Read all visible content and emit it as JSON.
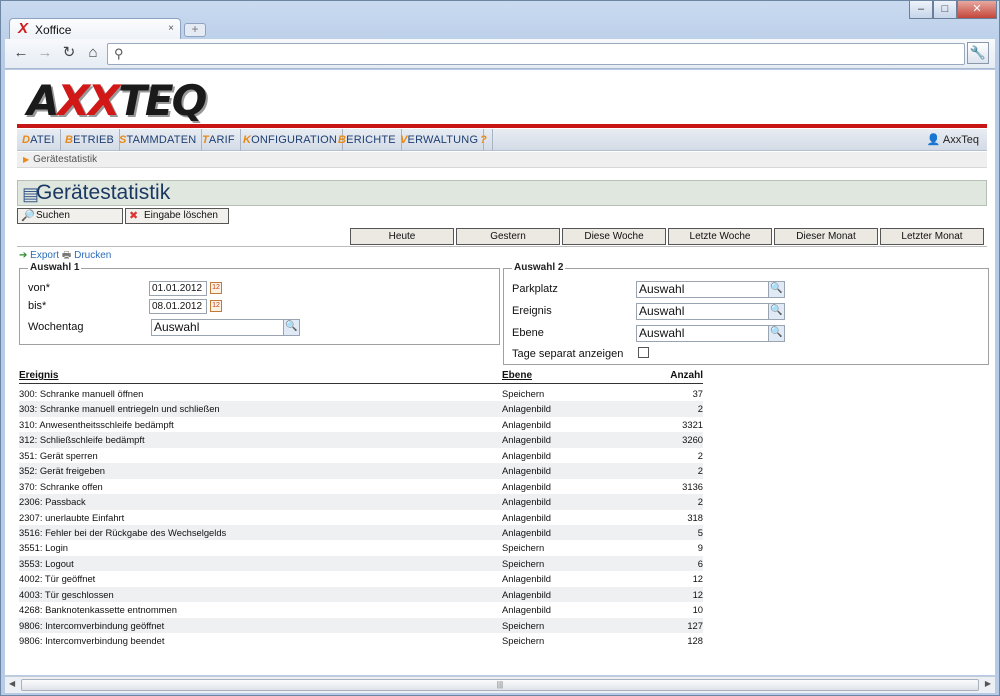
{
  "browser": {
    "tab_title": "Xoffice",
    "tab_logo": "X",
    "tab_close": "×",
    "new_tab": "+",
    "win_buttons": [
      "–",
      "□",
      "✕"
    ],
    "nav_icons": [
      "back-arrow-icon",
      "forward-arrow-icon",
      "reload-icon",
      "home-icon"
    ],
    "nav_glyphs": [
      "←",
      "→",
      "↻",
      "⌂"
    ],
    "url_icon": "⚲",
    "url_value": "",
    "wrench": "🔧"
  },
  "app": {
    "logo_a": "A",
    "logo_xx": "XX",
    "logo_teq": "TEQ",
    "menu": [
      {
        "first": "D",
        "rest": "ATEI"
      },
      {
        "first": "B",
        "rest": "ETRIEB"
      },
      {
        "first": "S",
        "rest": "TAMMDATEN"
      },
      {
        "first": "T",
        "rest": "ARIF"
      },
      {
        "first": "K",
        "rest": "ONFIGURATION"
      },
      {
        "first": "B",
        "rest": "ERICHTE"
      },
      {
        "first": "V",
        "rest": "ERWALTUNG"
      },
      {
        "first": "?",
        "rest": ""
      }
    ],
    "user": "AxxTeq",
    "breadcrumb": "Gerätestatistik",
    "page_title": "Gerätestatistik"
  },
  "toolbar": {
    "search": "Suchen",
    "clear": "Eingabe löschen"
  },
  "periods": [
    "Heute",
    "Gestern",
    "Diese Woche",
    "Letzte Woche",
    "Dieser Monat",
    "Letzter Monat"
  ],
  "export": {
    "export": "Export",
    "print": "Drucken"
  },
  "group1": {
    "legend": "Auswahl 1",
    "von_label": "von*",
    "von_value": "01.01.2012",
    "bis_label": "bis*",
    "bis_value": "08.01.2012",
    "wochentag_label": "Wochentag",
    "wochentag_value": "Auswahl"
  },
  "group2": {
    "legend": "Auswahl 2",
    "parkplatz_label": "Parkplatz",
    "parkplatz_value": "Auswahl",
    "ereignis_label": "Ereignis",
    "ereignis_value": "Auswahl",
    "ebene_label": "Ebene",
    "ebene_value": "Auswahl",
    "separate_label": "Tage separat anzeigen",
    "separate_checked": false
  },
  "table": {
    "headers": [
      "Ereignis",
      "Ebene",
      "Anzahl"
    ],
    "rows": [
      [
        "300: Schranke manuell öffnen",
        "Speichern",
        "37"
      ],
      [
        "303: Schranke manuell entriegeln und schließen",
        "Anlagenbild",
        "2"
      ],
      [
        "310: Anwesentheitsschleife bedämpft",
        "Anlagenbild",
        "3321"
      ],
      [
        "312: Schließschleife bedämpft",
        "Anlagenbild",
        "3260"
      ],
      [
        "351: Gerät sperren",
        "Anlagenbild",
        "2"
      ],
      [
        "352: Gerät freigeben",
        "Anlagenbild",
        "2"
      ],
      [
        "370: Schranke offen",
        "Anlagenbild",
        "3136"
      ],
      [
        "2306: Passback",
        "Anlagenbild",
        "2"
      ],
      [
        "2307: unerlaubte Einfahrt",
        "Anlagenbild",
        "318"
      ],
      [
        "3516: Fehler bei der Rückgabe des Wechselgelds",
        "Anlagenbild",
        "5"
      ],
      [
        "3551: Login",
        "Speichern",
        "9"
      ],
      [
        "3553: Logout",
        "Speichern",
        "6"
      ],
      [
        "4002: Tür geöffnet",
        "Anlagenbild",
        "12"
      ],
      [
        "4003: Tür geschlossen",
        "Anlagenbild",
        "12"
      ],
      [
        "4268: Banknotenkassette entnommen",
        "Anlagenbild",
        "10"
      ],
      [
        "9806: Intercomverbindung geöffnet",
        "Speichern",
        "127"
      ],
      [
        "9806: Intercomverbindung beendet",
        "Speichern",
        "128"
      ]
    ]
  },
  "scrollbar": {
    "grip": "|||",
    "left": "◀",
    "right": "▶"
  }
}
